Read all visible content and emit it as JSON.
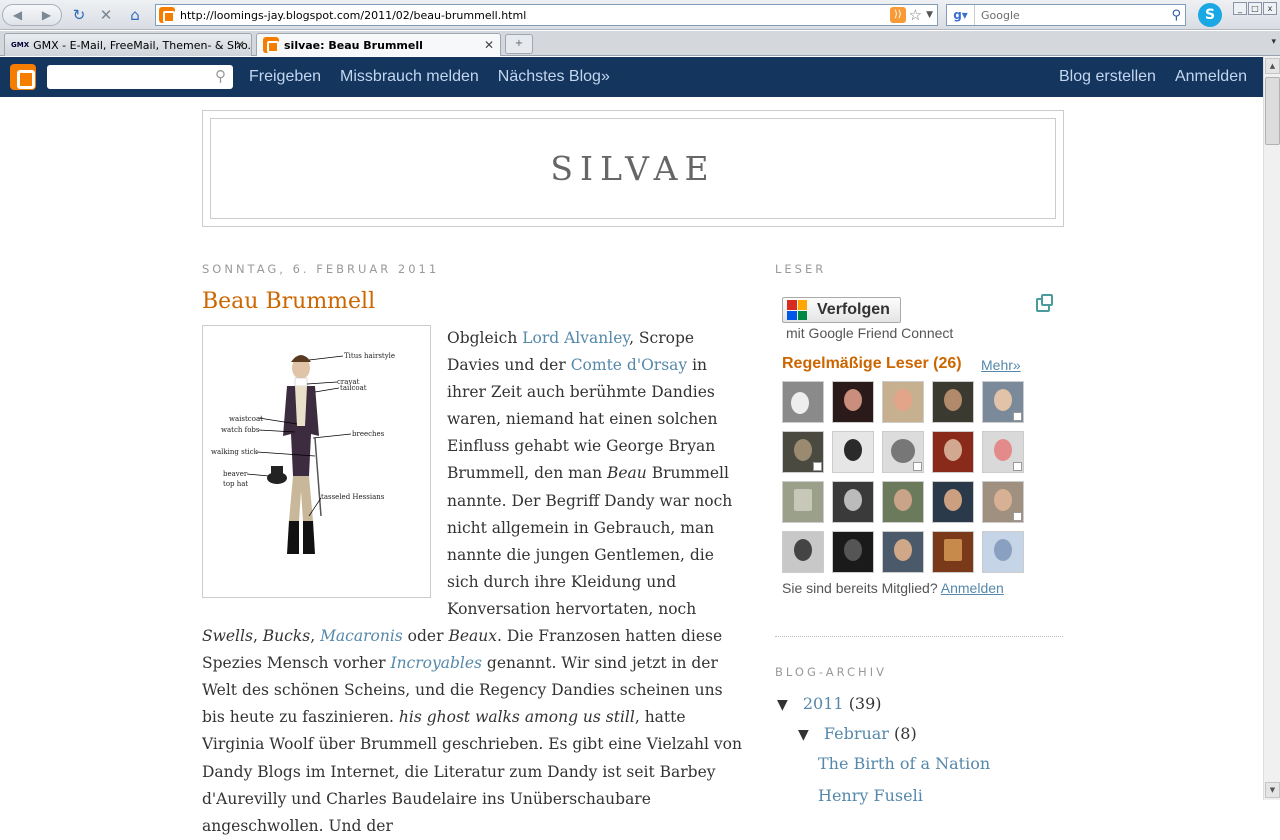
{
  "browser": {
    "url": "http://loomings-jay.blogspot.com/2011/02/beau-brummell.html",
    "search_placeholder": "Google",
    "tabs": [
      {
        "label": "GMX - E-Mail, FreeMail, Themen- & Sho...",
        "active": false
      },
      {
        "label": "silvae: Beau Brummell",
        "active": true
      }
    ]
  },
  "navbar": {
    "links_left": [
      "Freigeben",
      "Missbrauch melden",
      "Nächstes Blog»"
    ],
    "links_right": [
      "Blog erstellen",
      "Anmelden"
    ]
  },
  "blog": {
    "title": "SILVAE"
  },
  "post": {
    "date": "Sonntag, 6. Februar 2011",
    "title": "Beau Brummell",
    "figure_labels": [
      "Titus hairstyle",
      "cravat",
      "tailcoat",
      "waistcoat",
      "watch fobs",
      "breeches",
      "walking stick",
      "beaver",
      "top hat",
      "tasseled Hessians"
    ]
  },
  "sidebar": {
    "followers_heading": "Leser",
    "follow_button": "Verfolgen",
    "gfc_subtitle": "mit Google Friend Connect",
    "members_title": "Regelmäßige Leser (26)",
    "more_link": "Mehr»",
    "already_member_text": "Sie sind bereits Mitglied?",
    "already_member_link": "Anmelden",
    "archive_heading": "Blog-Archiv",
    "archive": [
      {
        "label": "2011",
        "count": "(39)",
        "level": 0,
        "expanded": true
      },
      {
        "label": "Februar",
        "count": "(8)",
        "level": 1,
        "expanded": true
      },
      {
        "label": "The Birth of a Nation",
        "count": "",
        "level": 2,
        "expanded": false
      },
      {
        "label": "Henry Fuseli",
        "count": "",
        "level": 2,
        "expanded": false
      }
    ]
  },
  "colors": {
    "accent": "#cc6600",
    "link": "#5588aa",
    "navbar": "#13355e",
    "blogger_orange": "#f57d00"
  }
}
